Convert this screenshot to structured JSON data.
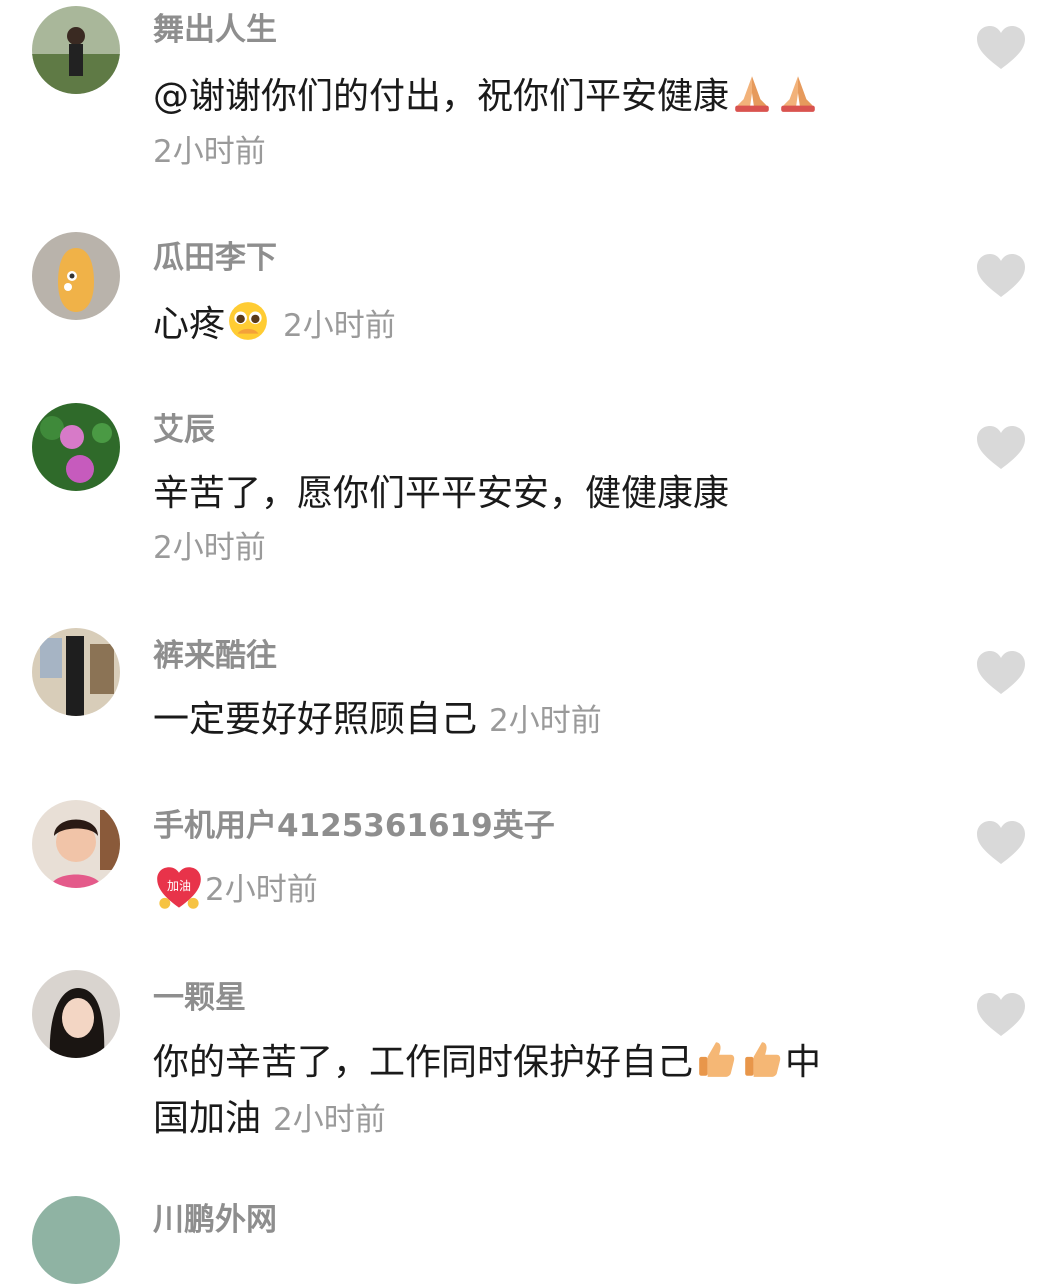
{
  "comments": [
    {
      "username": "舞出人生",
      "text": "@谢谢你们的付出，祝你们平安健康",
      "emojis": [
        "folded-hands",
        "folded-hands"
      ],
      "time": "2小时前"
    },
    {
      "username": "瓜田李下",
      "text": "心疼",
      "emojis": [
        "pleading-face"
      ],
      "time": "2小时前"
    },
    {
      "username": "艾辰",
      "text": "辛苦了，愿你们平平安安，健健康康",
      "emojis": [],
      "time": "2小时前"
    },
    {
      "username": "裤来酷往",
      "text": "一定要好好照顾自己",
      "emojis": [],
      "time": "2小时前"
    },
    {
      "username": "手机用户4125361619英子",
      "text": "",
      "emojis": [
        "jiayou-heart"
      ],
      "time": "2小时前",
      "sticker_text": "加油"
    },
    {
      "username": "一颗星",
      "text_line1": "你的辛苦了，工作同时保护好自己",
      "emojis": [
        "thumbs-up",
        "thumbs-up"
      ],
      "text_line1_tail": "中",
      "text_line2": "国加油",
      "time": "2小时前"
    },
    {
      "username": "川鹏外网"
    }
  ],
  "colors": {
    "username": "#8e8e8e",
    "text": "#1a1a1a",
    "time": "#9a9a9a",
    "like_icon": "#d9d9d9"
  },
  "icons": {
    "like": "heart-icon"
  }
}
